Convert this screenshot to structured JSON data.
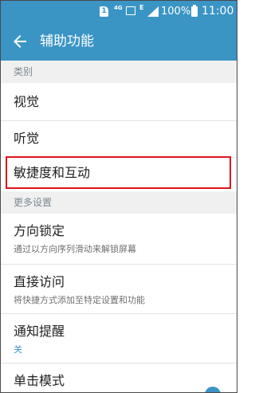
{
  "status": {
    "sim_slot": "1",
    "network": "4G",
    "e_mark": "E",
    "battery_text": "100%",
    "time": "11:00"
  },
  "appbar": {
    "title": "辅助功能"
  },
  "sections": [
    {
      "header": "类别",
      "items": [
        {
          "title": "视觉"
        },
        {
          "title": "听觉"
        },
        {
          "title": "敏捷度和互动"
        }
      ]
    },
    {
      "header": "更多设置",
      "items": [
        {
          "title": "方向锁定",
          "subtitle": "通过以方向序列滑动来解锁屏幕"
        },
        {
          "title": "直接访问",
          "subtitle": "将快捷方式添加至特定设置和功能"
        },
        {
          "title": "通知提醒",
          "subtitle": "关"
        },
        {
          "title": "单击模式"
        }
      ]
    }
  ],
  "colors": {
    "accent": "#3a95c5",
    "highlight": "#e2131a"
  }
}
